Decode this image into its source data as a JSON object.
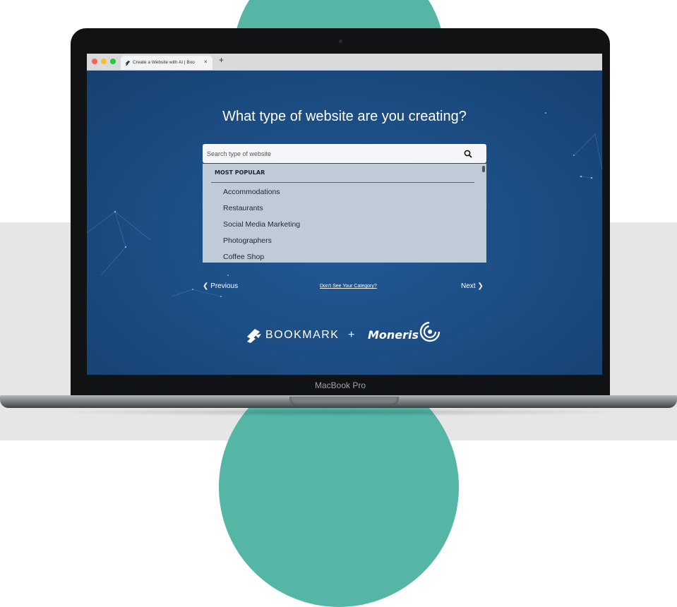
{
  "browser": {
    "tab_title": "Create a Website with AI | Boo",
    "close_glyph": "×",
    "new_tab_glyph": "+"
  },
  "page": {
    "heading": "What type of website are you creating?",
    "search": {
      "placeholder": "Search type of website",
      "value": ""
    },
    "dropdown": {
      "section_label": "MOST POPULAR",
      "items": [
        "Accommodations",
        "Restaurants",
        "Social Media Marketing",
        "Photographers",
        "Coffee Shop"
      ]
    },
    "nav": {
      "previous_label": "Previous",
      "category_link": "Don't See Your Category?",
      "next_label": "Next"
    },
    "partners": {
      "bookmark": "BOOKMARK",
      "plus": "+",
      "moneris": "Moneris"
    }
  },
  "device": {
    "brand_label": "MacBook Pro"
  },
  "colors": {
    "page_bg": "#1c4e86",
    "accent_teal": "#55b6a6",
    "dropdown_bg": "#bfccd8"
  }
}
